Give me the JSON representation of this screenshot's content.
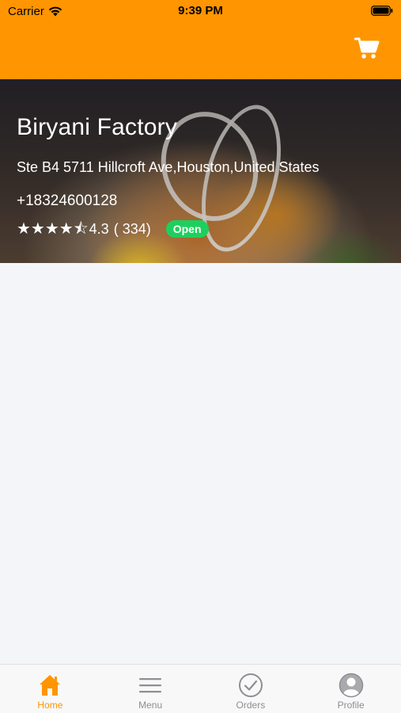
{
  "status_bar": {
    "carrier": "Carrier",
    "time": "9:39 PM"
  },
  "nav": {
    "cart_icon": "shopping-cart-icon"
  },
  "restaurant": {
    "name": "Biryani Factory",
    "address": "Ste B4 5711 Hillcroft Ave,Houston,United States",
    "phone": "+18324600128",
    "stars": "★★★★⯪",
    "rating": "4.3",
    "review_count": "( 334)",
    "status": "Open"
  },
  "tabs": [
    {
      "label": "Home",
      "icon": "home-icon",
      "active": true
    },
    {
      "label": "Menu",
      "icon": "menu-icon",
      "active": false
    },
    {
      "label": "Orders",
      "icon": "orders-checkmark-icon",
      "active": false
    },
    {
      "label": "Profile",
      "icon": "profile-icon",
      "active": false
    }
  ],
  "colors": {
    "accent": "#FF9500",
    "open_badge": "#1DD05E",
    "background": "#F4F5F9",
    "tab_inactive": "#8E8E93"
  }
}
